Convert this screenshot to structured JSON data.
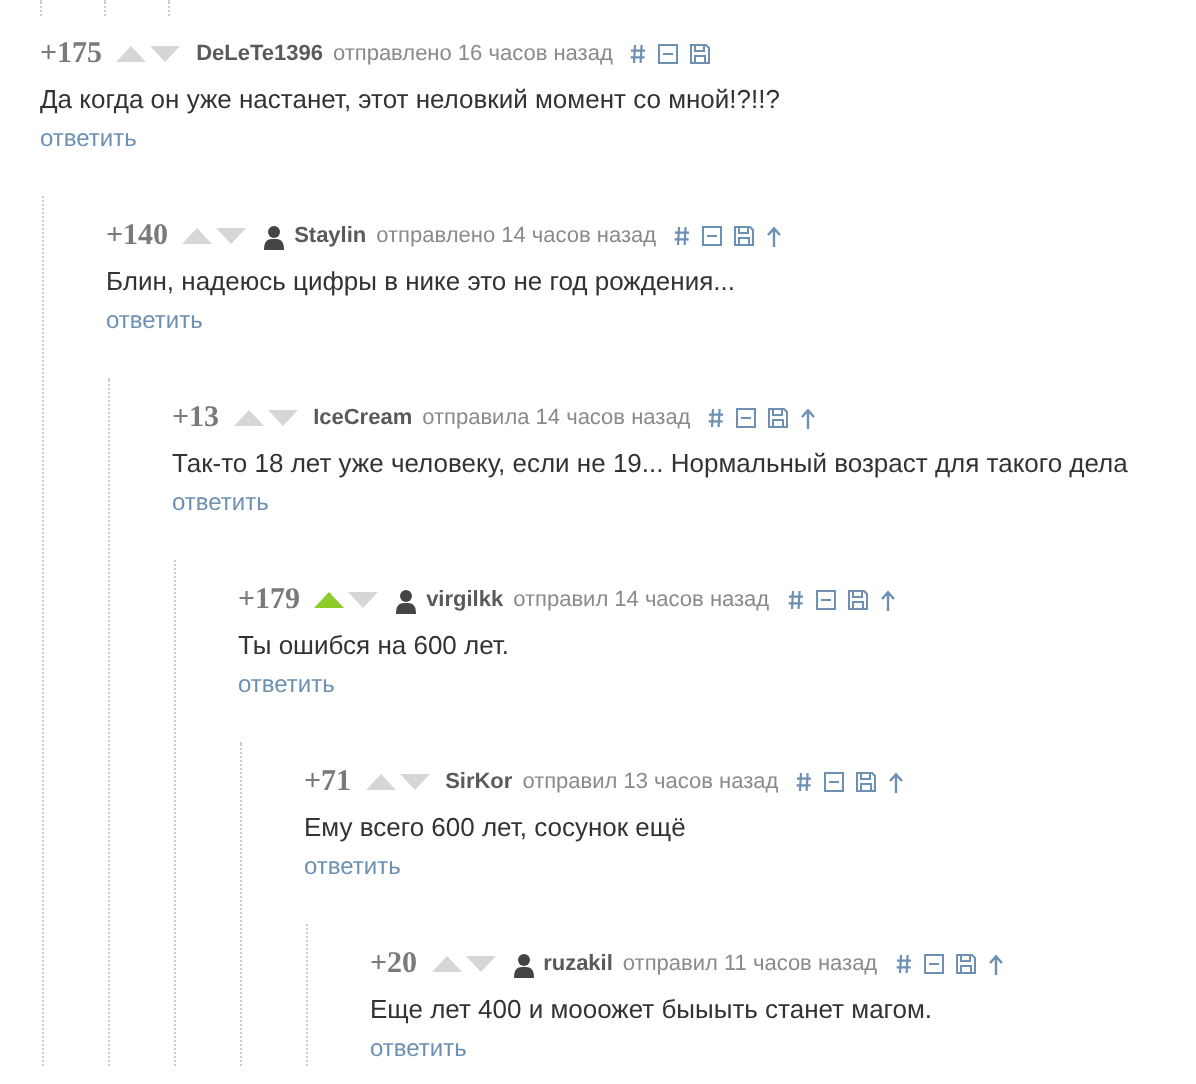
{
  "comments": [
    {
      "rating": "+175",
      "upvoted": false,
      "downvoted": false,
      "avatar": false,
      "author": "DeLeTe1396",
      "meta": "отправлено 16 часов назад",
      "parent_link": false,
      "text": "Да когда он уже настанет, этот неловкий момент со мной!?!!?",
      "reply": "ответить",
      "children": [
        {
          "rating": "+140",
          "upvoted": false,
          "downvoted": false,
          "avatar": true,
          "author": "Staylin",
          "meta": "отправлено 14 часов назад",
          "parent_link": true,
          "text": "Блин, надеюсь цифры в нике это не год рождения...",
          "reply": "ответить",
          "children": [
            {
              "rating": "+13",
              "upvoted": false,
              "downvoted": false,
              "avatar": false,
              "author": "IceCream",
              "meta": "отправила 14 часов назад",
              "parent_link": true,
              "text": "Так-то 18 лет уже человеку, если не 19... Нормальный возраст для такого дела",
              "reply": "ответить",
              "children": [
                {
                  "rating": "+179",
                  "upvoted": true,
                  "downvoted": false,
                  "avatar": true,
                  "author": "virgilkk",
                  "meta": "отправил 14 часов назад",
                  "parent_link": true,
                  "text": "Ты ошибся на 600 лет.",
                  "reply": "ответить",
                  "children": [
                    {
                      "rating": "+71",
                      "upvoted": false,
                      "downvoted": false,
                      "avatar": false,
                      "author": "SirKor",
                      "meta": "отправил 13 часов назад",
                      "parent_link": true,
                      "text": "Ему всего 600 лет, сосунок ещё",
                      "reply": "ответить",
                      "children": [
                        {
                          "rating": "+20",
                          "upvoted": false,
                          "downvoted": false,
                          "avatar": true,
                          "author": "ruzakil",
                          "meta": "отправил 11 часов назад",
                          "parent_link": true,
                          "text": "Еще лет 400 и мооожет быыыть станет магом.",
                          "reply": "ответить"
                        }
                      ]
                    }
                  ]
                }
              ]
            }
          ]
        }
      ]
    }
  ]
}
